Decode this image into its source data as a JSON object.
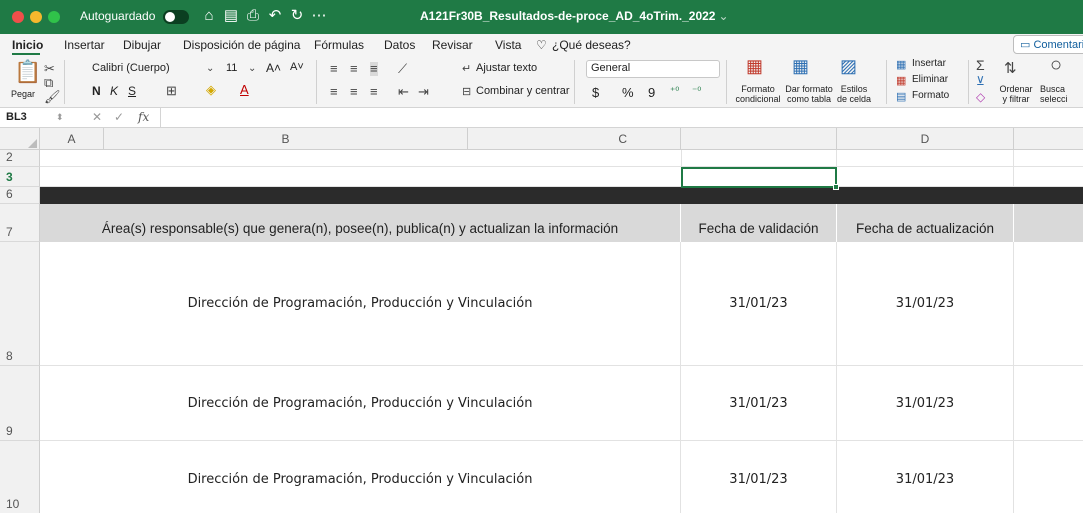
{
  "titlebar": {
    "autosave_label": "Autoguardado",
    "doc_title": "A121Fr30B_Resultados-de-proce_AD_4oTrim._2022",
    "icons": [
      "home-icon",
      "save-icon",
      "print-icon",
      "undo-icon",
      "redo-icon",
      "more-icon"
    ]
  },
  "menu": {
    "tabs": [
      "Inicio",
      "Insertar",
      "Dibujar",
      "Disposición de página",
      "Fórmulas",
      "Datos",
      "Revisar",
      "Vista"
    ],
    "tell_me": "¿Qué deseas?",
    "comment_label": "Comentari"
  },
  "ribbon": {
    "paste_label": "Pegar",
    "font_name": "Calibri (Cuerpo)",
    "font_size": "11",
    "wrap_text": "Ajustar texto",
    "merge_center": "Combinar y centrar",
    "number_format": "General",
    "currency": "$",
    "percent": "%",
    "thousands": "9",
    "cond_format_1": "Formato",
    "cond_format_2": "condicional",
    "table_format_1": "Dar formato",
    "table_format_2": "como tabla",
    "cell_styles_1": "Estilos",
    "cell_styles_2": "de celda",
    "insert": "Insertar",
    "delete": "Eliminar",
    "format": "Formato",
    "sort_1": "Ordenar",
    "sort_2": "y filtrar",
    "find_1": "Busca",
    "find_2": "selecci",
    "bold": "N",
    "italic": "K",
    "underline": "S"
  },
  "formula_bar": {
    "name_box": "BL3",
    "fx": "fx",
    "value": ""
  },
  "columns": [
    "A",
    "B",
    "C",
    "D"
  ],
  "rows": {
    "r2": "2",
    "r3": "3",
    "r6": "6",
    "r7": "7",
    "r8": "8",
    "r9": "9",
    "r10": "10"
  },
  "table_header": {
    "area": "Área(s) responsable(s) que genera(n), posee(n), publica(n) y actualizan la información",
    "validation_date": "Fecha de validación",
    "update_date": "Fecha de actualización"
  },
  "table_rows": [
    {
      "area": "Dirección de Programación, Producción y Vinculación",
      "validation": "31/01/23",
      "update": "31/01/23"
    },
    {
      "area": "Dirección de Programación, Producción y Vinculación",
      "validation": "31/01/23",
      "update": "31/01/23"
    },
    {
      "area": "Dirección de Programación, Producción y Vinculación",
      "validation": "31/01/23",
      "update": "31/01/23"
    }
  ],
  "colors": {
    "excel_green": "#1f7a45",
    "header_fill": "#d9d9d9",
    "black_band": "#2b2b2b"
  }
}
